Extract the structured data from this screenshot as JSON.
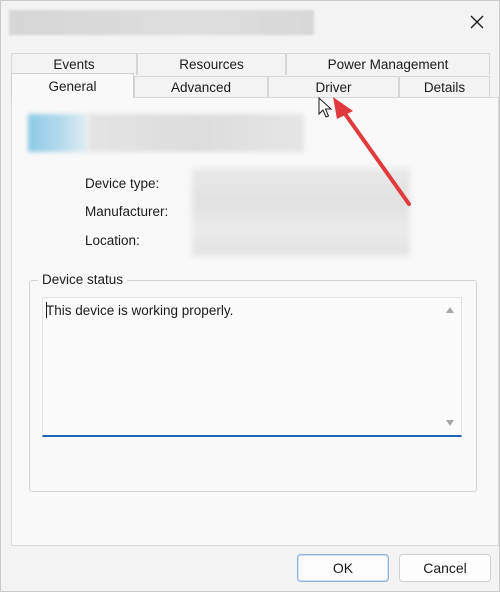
{
  "window": {
    "close_icon": "close-icon"
  },
  "tabs_row1": [
    {
      "label": "Events"
    },
    {
      "label": "Resources"
    },
    {
      "label": "Power Management"
    }
  ],
  "tabs_row2": [
    {
      "label": "General",
      "active": true
    },
    {
      "label": "Advanced"
    },
    {
      "label": "Driver"
    },
    {
      "label": "Details"
    }
  ],
  "properties": {
    "device_type_label": "Device type:",
    "manufacturer_label": "Manufacturer:",
    "location_label": "Location:"
  },
  "device_status": {
    "legend": "Device status",
    "text": "This device is working properly."
  },
  "buttons": {
    "ok": "OK",
    "cancel": "Cancel"
  },
  "annotation": {
    "arrow_color": "#e0393e"
  }
}
